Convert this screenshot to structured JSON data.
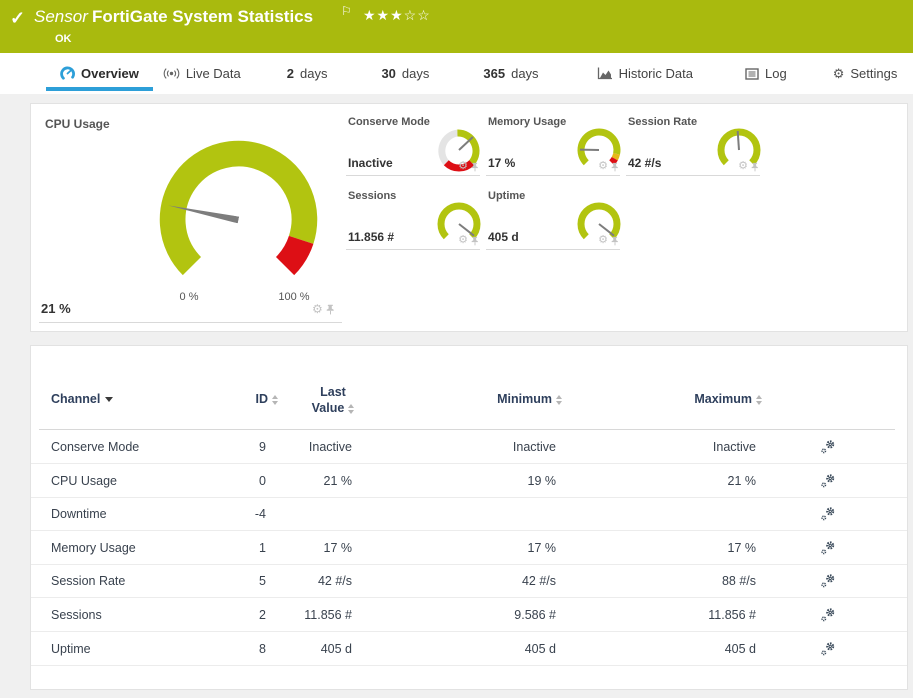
{
  "colors": {
    "header_green": "#a9ba0e",
    "gauge_green": "#b2c410",
    "alarm_red": "#dd0f15",
    "warn_yellow": "#e6b817",
    "inactive_gray_arc": "#e4e4e4",
    "needle_gray": "#7d7d7d",
    "tab_active_blue": "#2d9fd8",
    "table_header_navy": "#2e3f5c"
  },
  "app_header": {
    "status_icon": "✓",
    "kind_label": "Sensor",
    "title": "FortiGate System Statistics",
    "flag_icon": "⚐",
    "rating_filled": "★★★",
    "rating_empty": "☆☆",
    "status_text": "OK"
  },
  "tabs": {
    "overview": {
      "label": "Overview"
    },
    "live_data": {
      "label": "Live Data"
    },
    "days2": {
      "num": "2",
      "unit": "days"
    },
    "days30": {
      "num": "30",
      "unit": "days"
    },
    "days365": {
      "num": "365",
      "unit": "days"
    },
    "historic": {
      "label": "Historic Data"
    },
    "log": {
      "label": "Log"
    },
    "settings": {
      "label": "Settings"
    }
  },
  "gauges": {
    "cpu": {
      "title": "CPU Usage",
      "value": "21 %",
      "scale_min": "0 %",
      "scale_max": "100 %",
      "needle_deg": 281.7
    },
    "conserve_mode": {
      "title": "Conserve Mode",
      "value": "Inactive",
      "needle_deg": 47
    },
    "memory_usage": {
      "title": "Memory Usage",
      "value": "17 %",
      "needle_deg": 271
    },
    "session_rate": {
      "title": "Session Rate",
      "value": "42 #/s",
      "needle_deg": 356
    },
    "sessions": {
      "title": "Sessions",
      "value": "11.856 #",
      "needle_deg": 128
    },
    "uptime": {
      "title": "Uptime",
      "value": "405 d",
      "needle_deg": 128
    }
  },
  "table": {
    "headers": {
      "channel": "Channel",
      "id": "ID",
      "last_line1": "Last",
      "last_line2": "Value",
      "minimum": "Minimum",
      "maximum": "Maximum"
    },
    "rows": [
      {
        "channel": "Conserve Mode",
        "id": "9",
        "last": "Inactive",
        "min": "Inactive",
        "max": "Inactive"
      },
      {
        "channel": "CPU Usage",
        "id": "0",
        "last": "21 %",
        "min": "19 %",
        "max": "21 %"
      },
      {
        "channel": "Downtime",
        "id": "-4",
        "last": "",
        "min": "",
        "max": ""
      },
      {
        "channel": "Memory Usage",
        "id": "1",
        "last": "17 %",
        "min": "17 %",
        "max": "17 %"
      },
      {
        "channel": "Session Rate",
        "id": "5",
        "last": "42 #/s",
        "min": "42 #/s",
        "max": "88 #/s"
      },
      {
        "channel": "Sessions",
        "id": "2",
        "last": "11.856 #",
        "min": "9.586 #",
        "max": "11.856 #"
      },
      {
        "channel": "Uptime",
        "id": "8",
        "last": "405 d",
        "min": "405 d",
        "max": "405 d"
      }
    ]
  }
}
